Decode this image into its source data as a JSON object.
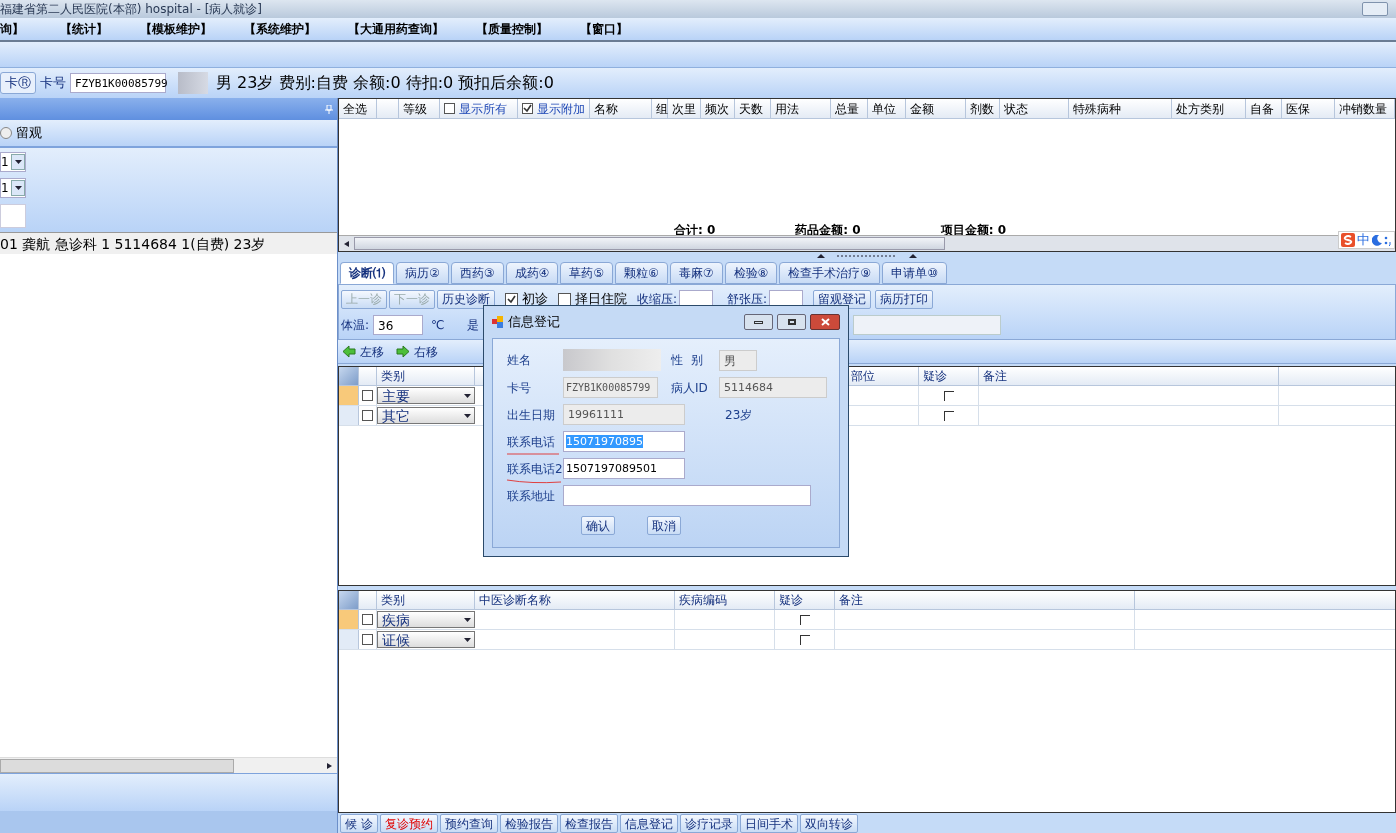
{
  "window": {
    "title": "福建省第二人民医院(本部) hospital - [病人就诊]"
  },
  "menu": [
    "询】",
    "【统计】",
    "【模板维护】",
    "【系统维护】",
    "【大通用药查询】",
    "【质量控制】",
    "【窗口】"
  ],
  "patient_bar": {
    "card_button": "卡Ⓡ",
    "card_label": "卡号",
    "card_no": "FZYB1K00085799",
    "info": "男 23岁 费别:自费 余额:0 待扣:0 预扣后余额:0"
  },
  "left_panel": {
    "radio": {
      "label": "留观",
      "selected": false
    },
    "selects": [
      "1",
      "1"
    ],
    "patient_row": "01 龚航 急诊科 1  5114684 1(自费) 23岁"
  },
  "order_grid": {
    "columns": [
      "全选",
      "",
      "等级",
      {
        "kind": "checkbox",
        "label": "显示所有",
        "checked": false
      },
      {
        "kind": "checkbox",
        "label": "显示附加",
        "checked": true
      },
      "名称",
      "组",
      "次里",
      "频次",
      "天数",
      "用法",
      "总量",
      "单位",
      "金额",
      "剂数",
      "状态",
      "特殊病种",
      "处方类别",
      "自备",
      "医保",
      "冲销数量"
    ],
    "totals": [
      "合计: 0",
      "药品金额: 0",
      "项目金额: 0"
    ]
  },
  "ime": {
    "label": "中"
  },
  "tabs": [
    {
      "label": "诊断⑴",
      "selected": true
    },
    {
      "label": "病历②",
      "selected": false
    },
    {
      "label": "西药③",
      "selected": false
    },
    {
      "label": "成药④",
      "selected": false
    },
    {
      "label": "草药⑤",
      "selected": false
    },
    {
      "label": "颗粒⑥",
      "selected": false
    },
    {
      "label": "毒麻⑦",
      "selected": false
    },
    {
      "label": "检验⑧",
      "selected": false
    },
    {
      "label": "检查手术治疗⑨",
      "selected": false
    },
    {
      "label": "申请单⑩",
      "selected": false
    }
  ],
  "toolbar": {
    "buttons": [
      {
        "label": "上一诊",
        "disabled": true
      },
      {
        "label": "下一诊",
        "disabled": true
      },
      {
        "label": "历史诊断",
        "disabled": false
      }
    ],
    "checks": [
      {
        "label": "初诊",
        "checked": true
      },
      {
        "label": "择日住院",
        "checked": false
      }
    ],
    "systolic": "收缩压:",
    "diastolic": "舒张压:",
    "actions": [
      "留观登记",
      "病历打印"
    ],
    "temp_label": "体温:",
    "temp_value": "36",
    "temp_unit": "℃",
    "cut_label": "是"
  },
  "move": [
    "左移",
    "右移"
  ],
  "diagnosis_grid": {
    "columns": [
      "类别",
      "部位",
      "疑诊",
      "备注"
    ],
    "rows": [
      {
        "category": "主要",
        "selected": true,
        "checked": false,
        "suspect": false
      },
      {
        "category": "其它",
        "selected": false,
        "checked": false,
        "suspect": false
      }
    ]
  },
  "tcm_grid": {
    "columns": [
      "类别",
      "中医诊断名称",
      "疾病编码",
      "疑诊",
      "备注"
    ],
    "rows": [
      {
        "category": "疾病",
        "selected": true,
        "checked": false,
        "suspect": false
      },
      {
        "category": "证候",
        "selected": false,
        "checked": false,
        "suspect": false
      }
    ]
  },
  "bottom_buttons": [
    {
      "label": "候 诊",
      "alert": false
    },
    {
      "label": "复诊预约",
      "alert": true
    },
    {
      "label": "预约查询",
      "alert": false
    },
    {
      "label": "检验报告",
      "alert": false
    },
    {
      "label": "检查报告",
      "alert": false
    },
    {
      "label": "信息登记",
      "alert": false
    },
    {
      "label": "诊疗记录",
      "alert": false
    },
    {
      "label": "日间手术",
      "alert": false
    },
    {
      "label": "双向转诊",
      "alert": false
    }
  ],
  "dialog": {
    "title": "信息登记",
    "name_label": "姓名",
    "sex_label": "性  别",
    "sex": "男",
    "card_label": "卡号",
    "card": "FZYB1K00085799",
    "pid_label": "病人ID",
    "pid": "5114684",
    "birth_label": "出生日期",
    "birth": "19961111",
    "age": "23岁",
    "phone_label": "联系电话",
    "phone": "15071970895",
    "phone_selected": true,
    "phone2_label": "联系电话2",
    "phone2": "1507197089501",
    "address_label": "联系地址",
    "ok": "确认",
    "cancel": "取消"
  }
}
